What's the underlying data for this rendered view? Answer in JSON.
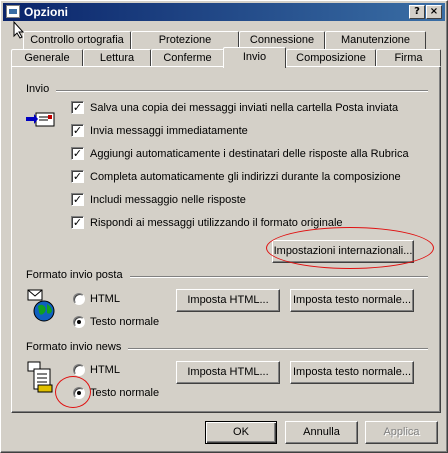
{
  "window": {
    "title": "Opzioni",
    "help_label": "?",
    "close_label": "×"
  },
  "tabs": {
    "row1": [
      "Controllo ortografia",
      "Protezione",
      "Connessione",
      "Manutenzione"
    ],
    "row2": [
      "Generale",
      "Lettura",
      "Conferme",
      "Invio",
      "Composizione",
      "Firma"
    ],
    "active": "Invio"
  },
  "send_group": {
    "title": "Invio",
    "options": [
      {
        "label": "Salva una copia dei messaggi inviati nella cartella Posta inviata",
        "checked": true
      },
      {
        "label": "Invia messaggi immediatamente",
        "checked": true
      },
      {
        "label": "Aggiungi automaticamente i destinatari delle risposte alla Rubrica",
        "checked": true
      },
      {
        "label": "Completa automaticamente gli indirizzi durante la composizione",
        "checked": true
      },
      {
        "label": "Includi messaggio nelle risposte",
        "checked": true
      },
      {
        "label": "Rispondi ai messaggi utilizzando il formato originale",
        "checked": true
      }
    ],
    "intl_button": "Impostazioni internazionali..."
  },
  "mail_format": {
    "title": "Formato invio posta",
    "html_label": "HTML",
    "text_label": "Testo normale",
    "selected": "Testo normale",
    "html_settings_button": "Imposta HTML...",
    "text_settings_button": "Imposta testo normale..."
  },
  "news_format": {
    "title": "Formato invio news",
    "html_label": "HTML",
    "text_label": "Testo normale",
    "selected": "Testo normale",
    "html_settings_button": "Imposta HTML...",
    "text_settings_button": "Imposta testo normale..."
  },
  "footer": {
    "ok": "OK",
    "cancel": "Annulla",
    "apply": "Applica"
  },
  "annotation_color": "#e01010",
  "titlebar_color": "#0a246a"
}
